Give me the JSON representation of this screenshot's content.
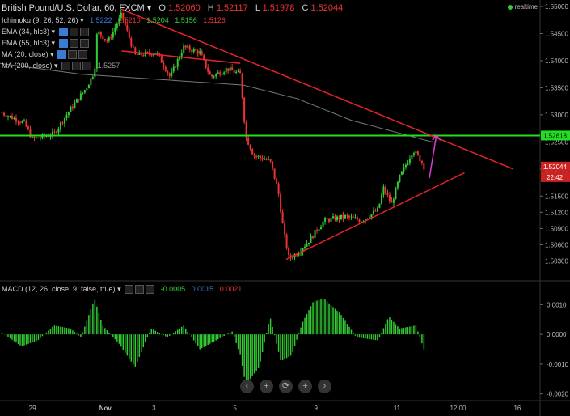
{
  "header": {
    "symbol": "British Pound/U.S. Dollar, 60, FXCM",
    "o_label": "O",
    "o": "1.52060",
    "h_label": "H",
    "h": "1.52117",
    "l_label": "L",
    "l": "1.51978",
    "c_label": "C",
    "c": "1.52044"
  },
  "indicators": [
    {
      "name": "Ichimoku (9, 26, 52, 26)",
      "values": [
        "1.5222",
        "1.5210",
        "1.5204",
        "1.5156",
        "1.5126"
      ]
    },
    {
      "name": "EMA (34, hlc3)",
      "values": []
    },
    {
      "name": "EMA (55, hlc3)",
      "values": []
    },
    {
      "name": "MA (20, close)",
      "values": []
    },
    {
      "name": "MA (200, close)",
      "values": [
        "1.5257"
      ]
    }
  ],
  "macd": {
    "name": "MACD (12, 26, close, 9, false, true)",
    "values": [
      "-0.0005",
      "0.0015",
      "0.0021"
    ],
    "colors": [
      "#3c3",
      "#3a7bd5",
      "#e33"
    ]
  },
  "realtime_label": "realtime",
  "nav_buttons": [
    "‹",
    "+",
    "⟳",
    "+",
    "›"
  ],
  "price_badges": {
    "price": "1.52044",
    "time": "22:42",
    "green": "1.52618"
  },
  "colors": {
    "up": "#3c3",
    "down": "#e33",
    "trend": "#e8222b",
    "support": "#22dd22",
    "arrow": "#e03ad8",
    "ma": "#777"
  },
  "chart_data": [
    {
      "type": "candlestick",
      "title": "British Pound/U.S. Dollar, 60, FXCM",
      "x_tick_labels": [
        "29",
        "Nov",
        "3",
        "5",
        "9",
        "11",
        "12:00",
        "16"
      ],
      "y_tick_labels": [
        "1.55000",
        "1.54500",
        "1.54000",
        "1.53500",
        "1.53000",
        "1.52500",
        "1.52000",
        "1.51500",
        "1.51200",
        "1.50900",
        "1.50600",
        "1.50300"
      ],
      "ylim": [
        1.4995,
        1.5512
      ],
      "horizontal_line": 1.52618,
      "trendlines": [
        {
          "from": [
            0.225,
            1.5495
          ],
          "to": [
            0.95,
            1.52
          ]
        },
        {
          "from": [
            0.225,
            1.5418
          ],
          "to": [
            0.445,
            1.5395
          ]
        },
        {
          "from": [
            0.53,
            1.5033
          ],
          "to": [
            0.86,
            1.5193
          ]
        }
      ],
      "arrow": {
        "from": [
          0.795,
          1.5183
        ],
        "to": [
          0.808,
          1.5262
        ]
      },
      "price_keypoints": [
        [
          0.0,
          1.5305
        ],
        [
          0.045,
          1.5285
        ],
        [
          0.06,
          1.5255
        ],
        [
          0.1,
          1.5265
        ],
        [
          0.13,
          1.531
        ],
        [
          0.16,
          1.535
        ],
        [
          0.175,
          1.538
        ],
        [
          0.18,
          1.5455
        ],
        [
          0.2,
          1.5435
        ],
        [
          0.225,
          1.5485
        ],
        [
          0.25,
          1.541
        ],
        [
          0.29,
          1.5415
        ],
        [
          0.315,
          1.537
        ],
        [
          0.34,
          1.5425
        ],
        [
          0.37,
          1.5415
        ],
        [
          0.39,
          1.537
        ],
        [
          0.42,
          1.5385
        ],
        [
          0.445,
          1.5375
        ],
        [
          0.455,
          1.526
        ],
        [
          0.47,
          1.5225
        ],
        [
          0.5,
          1.5215
        ],
        [
          0.515,
          1.516
        ],
        [
          0.525,
          1.5085
        ],
        [
          0.535,
          1.5035
        ],
        [
          0.55,
          1.5045
        ],
        [
          0.57,
          1.5065
        ],
        [
          0.6,
          1.5105
        ],
        [
          0.64,
          1.5112
        ],
        [
          0.67,
          1.5105
        ],
        [
          0.7,
          1.5125
        ],
        [
          0.71,
          1.5165
        ],
        [
          0.725,
          1.5135
        ],
        [
          0.74,
          1.5185
        ],
        [
          0.765,
          1.5235
        ],
        [
          0.78,
          1.5215
        ],
        [
          0.785,
          1.5204
        ]
      ],
      "ma200_keypoints": [
        [
          0.0,
          1.5395
        ],
        [
          0.15,
          1.5375
        ],
        [
          0.3,
          1.5365
        ],
        [
          0.45,
          1.5355
        ],
        [
          0.55,
          1.533
        ],
        [
          0.65,
          1.529
        ],
        [
          0.8,
          1.525
        ]
      ]
    },
    {
      "type": "bar",
      "title": "MACD (12, 26, close, 9, false, true)",
      "y_tick_labels": [
        "0.0010",
        "0.0000",
        "-0.0010",
        "-0.0020"
      ],
      "ylim": [
        -0.0022,
        0.0018
      ],
      "hist_keypoints": [
        [
          0.0,
          0.0001
        ],
        [
          0.04,
          -0.0004
        ],
        [
          0.07,
          -0.0002
        ],
        [
          0.1,
          0.0003
        ],
        [
          0.13,
          0.0002
        ],
        [
          0.15,
          -0.0001
        ],
        [
          0.175,
          0.0012
        ],
        [
          0.19,
          0.0003
        ],
        [
          0.22,
          -0.0003
        ],
        [
          0.25,
          -0.0011
        ],
        [
          0.28,
          0.0002
        ],
        [
          0.31,
          -0.0001
        ],
        [
          0.34,
          0.0003
        ],
        [
          0.37,
          -0.0005
        ],
        [
          0.4,
          -0.0002
        ],
        [
          0.43,
          0.0001
        ],
        [
          0.445,
          -0.0007
        ],
        [
          0.455,
          -0.0017
        ],
        [
          0.48,
          -0.0011
        ],
        [
          0.5,
          0.0006
        ],
        [
          0.52,
          -0.0009
        ],
        [
          0.54,
          -0.0007
        ],
        [
          0.56,
          0.0004
        ],
        [
          0.58,
          0.0011
        ],
        [
          0.6,
          0.0012
        ],
        [
          0.63,
          0.0007
        ],
        [
          0.66,
          -0.0001
        ],
        [
          0.7,
          -0.0002
        ],
        [
          0.72,
          0.0006
        ],
        [
          0.74,
          0.0002
        ],
        [
          0.77,
          0.0003
        ],
        [
          0.785,
          -0.0005
        ]
      ]
    }
  ]
}
